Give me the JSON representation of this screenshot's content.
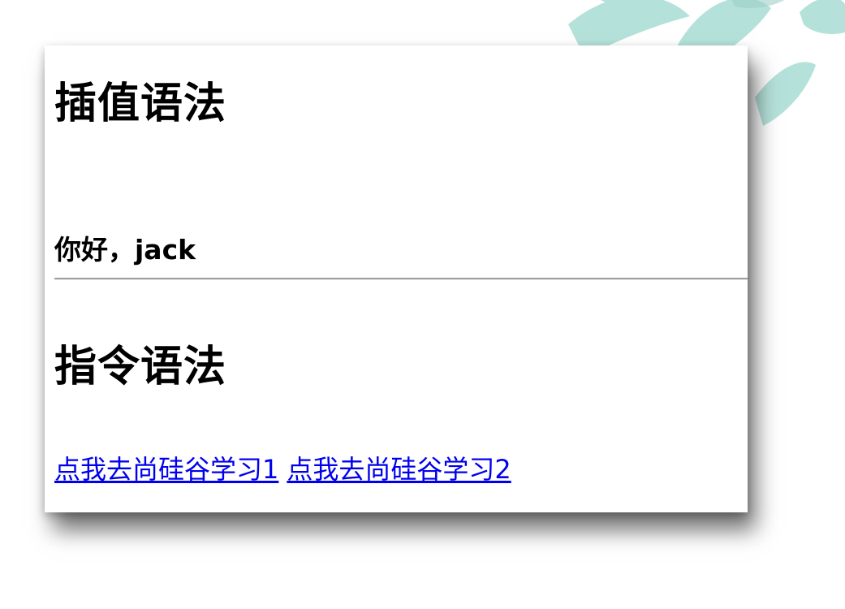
{
  "page": {
    "background": "#ffffff",
    "accent_watermark": "#a8dcd3"
  },
  "section_interpolation": {
    "heading": "插值语法",
    "greeting": "你好，jack"
  },
  "section_directive": {
    "heading": "指令语法",
    "links": [
      {
        "label": "点我去尚硅谷学习1"
      },
      {
        "label": "点我去尚硅谷学习2"
      }
    ],
    "link_color": "#0000ee"
  }
}
